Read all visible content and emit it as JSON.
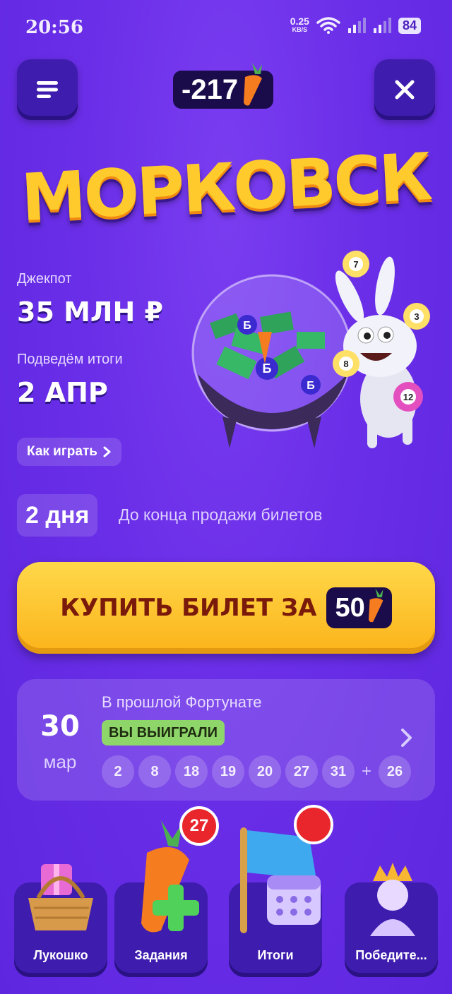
{
  "status_bar": {
    "time": "20:56",
    "net_speed": "0.25",
    "net_unit": "KB/S",
    "battery": "84"
  },
  "header": {
    "balance": "-217"
  },
  "logo": {
    "text": "МОРКОВСК"
  },
  "jackpot": {
    "label": "Джекпот",
    "value": "35 МЛН ₽"
  },
  "results": {
    "label": "Подведём итоги",
    "value": "2 АПР"
  },
  "how_to_play": {
    "label": "Как играть"
  },
  "countdown": {
    "value": "2 дня",
    "text": "До конца продажи билетов"
  },
  "buy": {
    "label": "КУПИТЬ БИЛЕТ ЗА",
    "price": "50"
  },
  "last_draw": {
    "day": "30",
    "month": "мар",
    "title": "В прошлой Фортунате",
    "status": "ВЫ ВЫИГРАЛИ",
    "numbers": [
      "2",
      "8",
      "18",
      "19",
      "20",
      "27",
      "31"
    ],
    "plus": "+",
    "bonus": "26"
  },
  "nav": [
    {
      "label": "Лукошко"
    },
    {
      "label": "Задания",
      "badge": "27"
    },
    {
      "label": "Итоги"
    },
    {
      "label": "Победите..."
    }
  ],
  "illustration_balls": [
    "7",
    "3",
    "8",
    "12"
  ],
  "colors": {
    "background": "#6a2ee8",
    "button": "#3d1cae",
    "buy_button": "#fbc12a",
    "won_badge": "#8fd66a",
    "badge": "#e8262b"
  }
}
